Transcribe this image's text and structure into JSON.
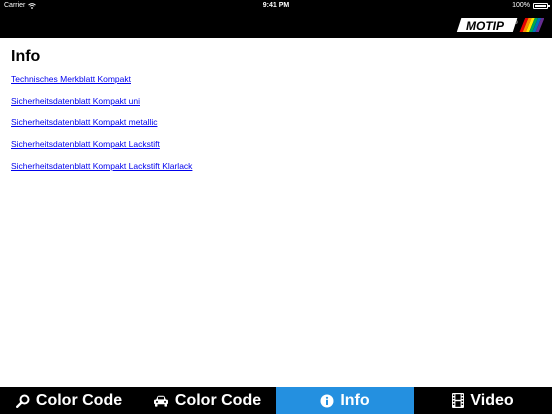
{
  "status_bar": {
    "carrier": "Carrier",
    "time": "9:41 PM",
    "battery": "100%"
  },
  "header": {
    "logo_text": "MOTIP",
    "logo_mark": "®"
  },
  "main": {
    "title": "Info",
    "links": [
      "Technisches Merkblatt Kompakt",
      "Sicherheitsdatenblatt Kompakt uni",
      "Sicherheitsdatenblatt Kompakt metallic",
      "Sicherheitsdatenblatt Kompakt Lackstift",
      "Sicherheitsdatenblatt Kompakt Lackstift Klarlack"
    ]
  },
  "tabs": [
    {
      "label": "Color Code",
      "icon": "search-icon"
    },
    {
      "label": "Color Code",
      "icon": "car-icon"
    },
    {
      "label": "Info",
      "icon": "info-icon",
      "active": true
    },
    {
      "label": "Video",
      "icon": "film-icon"
    }
  ],
  "colors": {
    "bar_background": "#000000",
    "active_tab": "#2490e0",
    "link": "#0000ee",
    "logo_stripes": [
      "#e60000",
      "#ff8c00",
      "#ffe600",
      "#00a651",
      "#0072bc",
      "#662d91"
    ]
  }
}
